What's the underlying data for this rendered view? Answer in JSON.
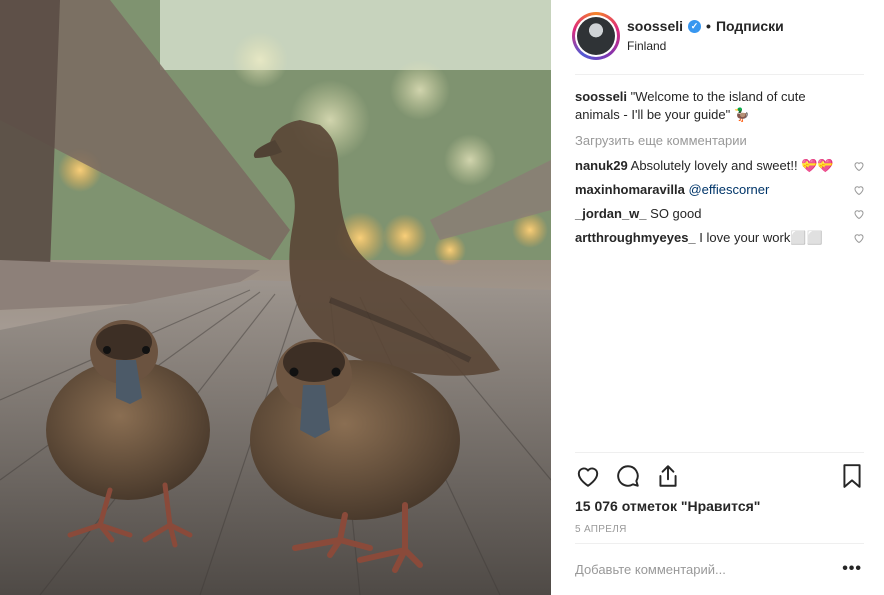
{
  "post": {
    "username": "soosseli",
    "follow_label": "Подписки",
    "separator": "•",
    "location": "Finland",
    "caption_text": "\"Welcome to the island of cute animals - I'll be your guide\" 🦆",
    "load_more": "Загрузить еще комментарии",
    "comments": [
      {
        "user": "nanuk29",
        "text": "Absolutely lovely and sweet!! 💝💝"
      },
      {
        "user": "maxinhomaravilla",
        "text": "@effiescorner"
      },
      {
        "user": "_jordan_w_",
        "text": "SO good"
      },
      {
        "user": "artthroughmyeyes_",
        "text": "I love your work⬜⬜"
      }
    ],
    "likes": "15 076 отметок \"Нравится\"",
    "date": "5 АПРЕЛЯ",
    "add_comment_placeholder": "Добавьте комментарий...",
    "more_label": "•••"
  },
  "icons": {
    "verified": "verified-badge-icon",
    "like": "heart-icon",
    "comment": "comment-bubble-icon",
    "share": "share-icon",
    "save": "bookmark-icon",
    "comment_like": "small-heart-icon"
  },
  "colors": {
    "verified_blue": "#3897f0",
    "muted_text": "#999999",
    "mention": "#003569"
  }
}
